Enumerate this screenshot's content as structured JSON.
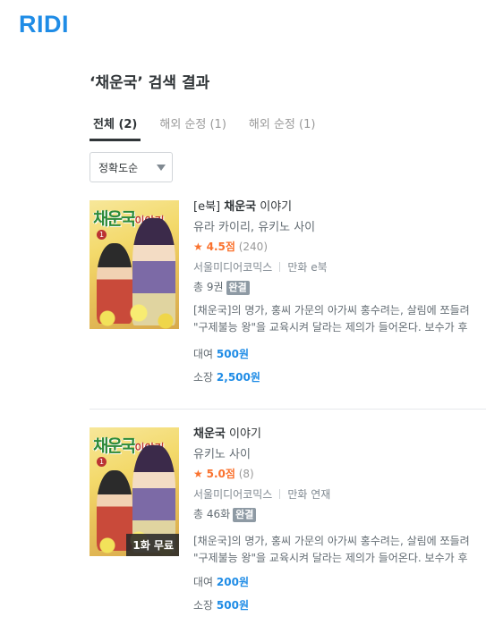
{
  "header": {
    "logo": "RIDI"
  },
  "search": {
    "heading": "‘채운국’ 검색 결과"
  },
  "tabs": [
    {
      "label": "전체 (2)",
      "active": true
    },
    {
      "label": "해외 순정 (1)",
      "active": false
    },
    {
      "label": "해외 순정 (1)",
      "active": false
    }
  ],
  "sort": {
    "selected": "정확도순",
    "icon": "caret-down-icon"
  },
  "books": [
    {
      "cover_title": "채운국",
      "cover_subtitle": "이야기",
      "volume": "1",
      "format_prefix": "[e북] ",
      "title_bold": "채운국",
      "title_rest": " 이야기",
      "authors": "유라 카이리, 유키노 사이",
      "rating_star": "★",
      "rating_score": "4.5점",
      "rating_count": "(240)",
      "publisher": "서울미디어코믹스",
      "category": "만화 e북",
      "total": "총 9권",
      "status": "완결",
      "desc_line1": "[채운국]의 명가, 홍씨 가문의 아가씨 홍수려는, 살림에 쪼들려",
      "desc_line2": "\"구제불능 왕\"을 교육시켜 달라는 제의가 들어온다. 보수가 후",
      "rent_label": "대여",
      "rent_price": "500원",
      "own_label": "소장",
      "own_price": "2,500원",
      "free_badge": ""
    },
    {
      "cover_title": "채운국",
      "cover_subtitle": "이야기",
      "volume": "1",
      "format_prefix": "",
      "title_bold": "채운국",
      "title_rest": " 이야기",
      "authors": "유키노 사이",
      "rating_star": "★",
      "rating_score": "5.0점",
      "rating_count": "(8)",
      "publisher": "서울미디어코믹스",
      "category": "만화 연재",
      "total": "총 46화",
      "status": "완결",
      "desc_line1": "[채운국]의 명가, 홍씨 가문의 아가씨 홍수려는, 살림에 쪼들려",
      "desc_line2": "\"구제불능 왕\"을 교육시켜 달라는 제의가 들어온다. 보수가 후",
      "rent_label": "대여",
      "rent_price": "200원",
      "own_label": "소장",
      "own_price": "500원",
      "free_badge": "1화 무료"
    }
  ],
  "colors": {
    "brand": "#1f8ce6",
    "rating": "#fa722e",
    "badge": "#8e9aa4"
  }
}
